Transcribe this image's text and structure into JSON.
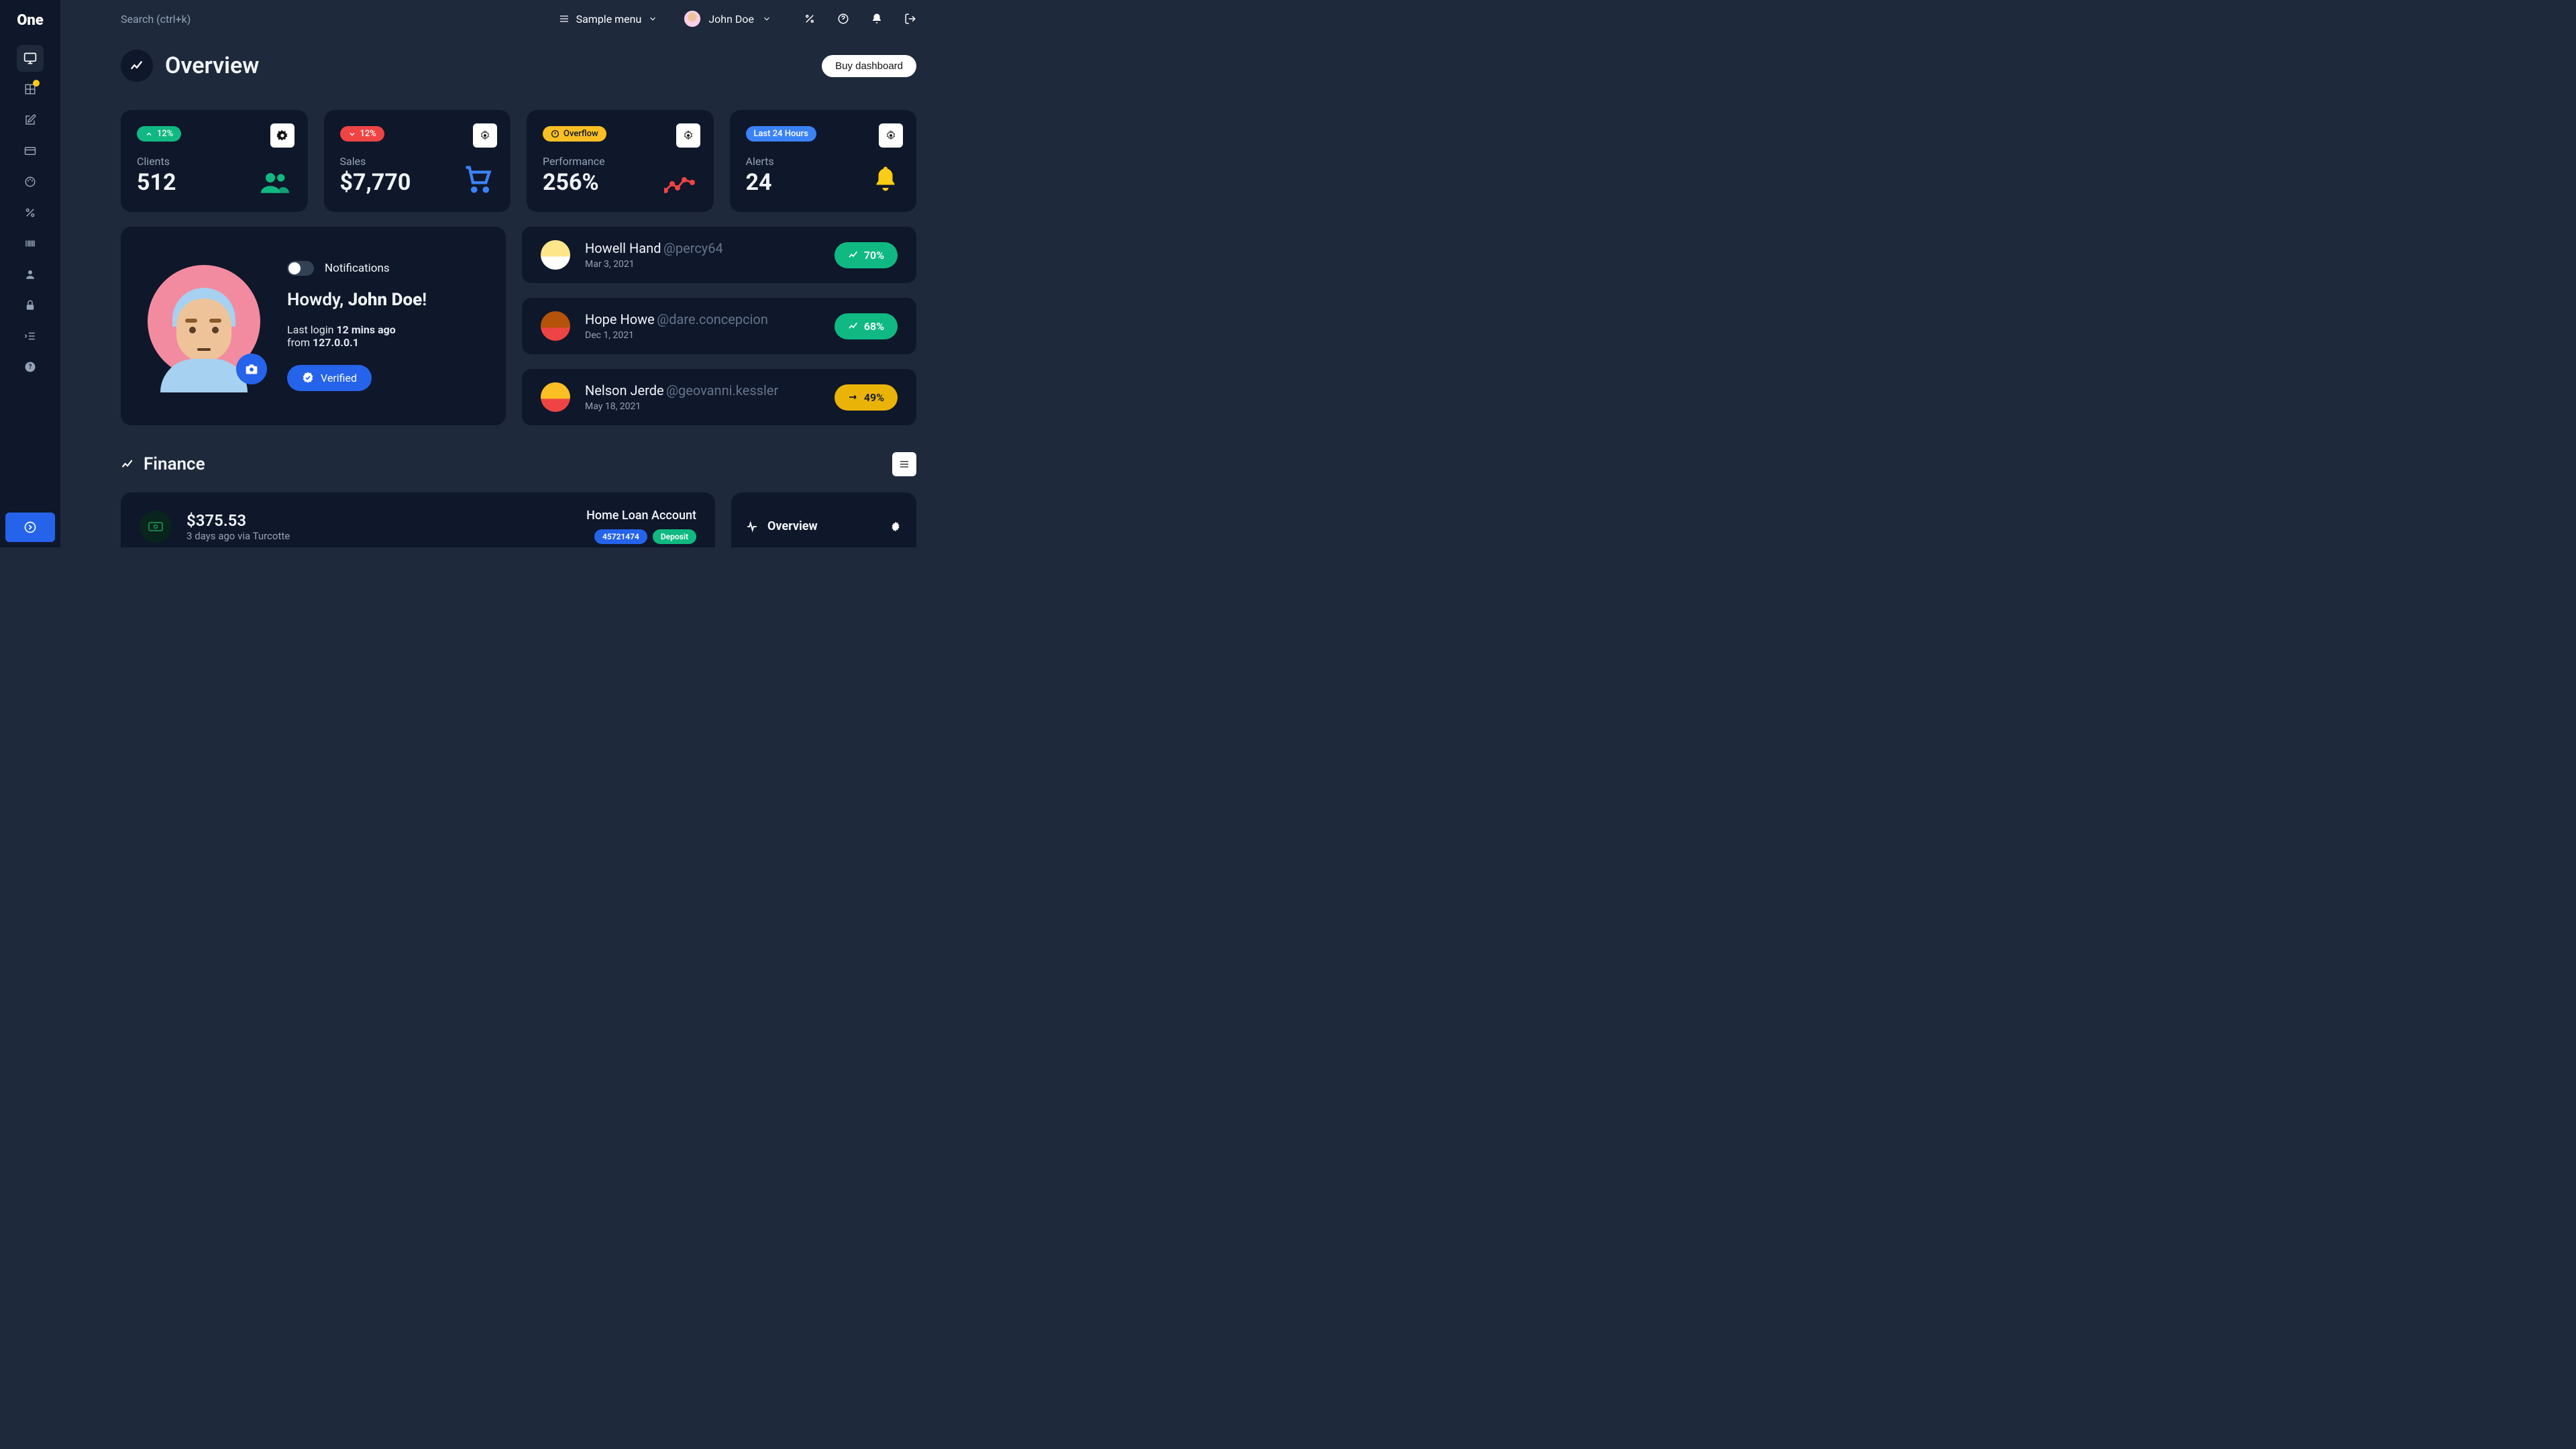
{
  "app": {
    "name": "One"
  },
  "topbar": {
    "search_placeholder": "Search (ctrl+k)",
    "sample_menu": "Sample menu",
    "user_name": "John Doe"
  },
  "page": {
    "title": "Overview",
    "buy_btn": "Buy dashboard"
  },
  "stats": {
    "clients": {
      "label": "Clients",
      "value": "512",
      "badge": "12%"
    },
    "sales": {
      "label": "Sales",
      "value": "$7,770",
      "badge": "12%"
    },
    "performance": {
      "label": "Performance",
      "value": "256%",
      "badge": "Overflow"
    },
    "alerts": {
      "label": "Alerts",
      "value": "24",
      "badge": "Last 24 Hours"
    }
  },
  "profile": {
    "notifications_label": "Notifications",
    "greeting_prefix": "Howdy, ",
    "greeting_name": "John Doe",
    "greeting_suffix": "!",
    "last_login_prefix": "Last login ",
    "last_login_time": "12 mins ago",
    "from_prefix": "from ",
    "ip": "127.0.0.1",
    "verified": "Verified"
  },
  "people": [
    {
      "name": "Howell Hand",
      "handle": "@percy64",
      "date": "Mar 3, 2021",
      "pct": "70%",
      "color": "green"
    },
    {
      "name": "Hope Howe",
      "handle": "@dare.concepcion",
      "date": "Dec 1, 2021",
      "pct": "68%",
      "color": "green"
    },
    {
      "name": "Nelson Jerde",
      "handle": "@geovanni.kessler",
      "date": "May 18, 2021",
      "pct": "49%",
      "color": "yellow"
    }
  ],
  "finance": {
    "title": "Finance",
    "amount": "$375.53",
    "sub": "3 days ago via Turcotte",
    "account": "Home Loan Account",
    "chip1": "45721474",
    "chip2": "Deposit",
    "overview": "Overview"
  }
}
